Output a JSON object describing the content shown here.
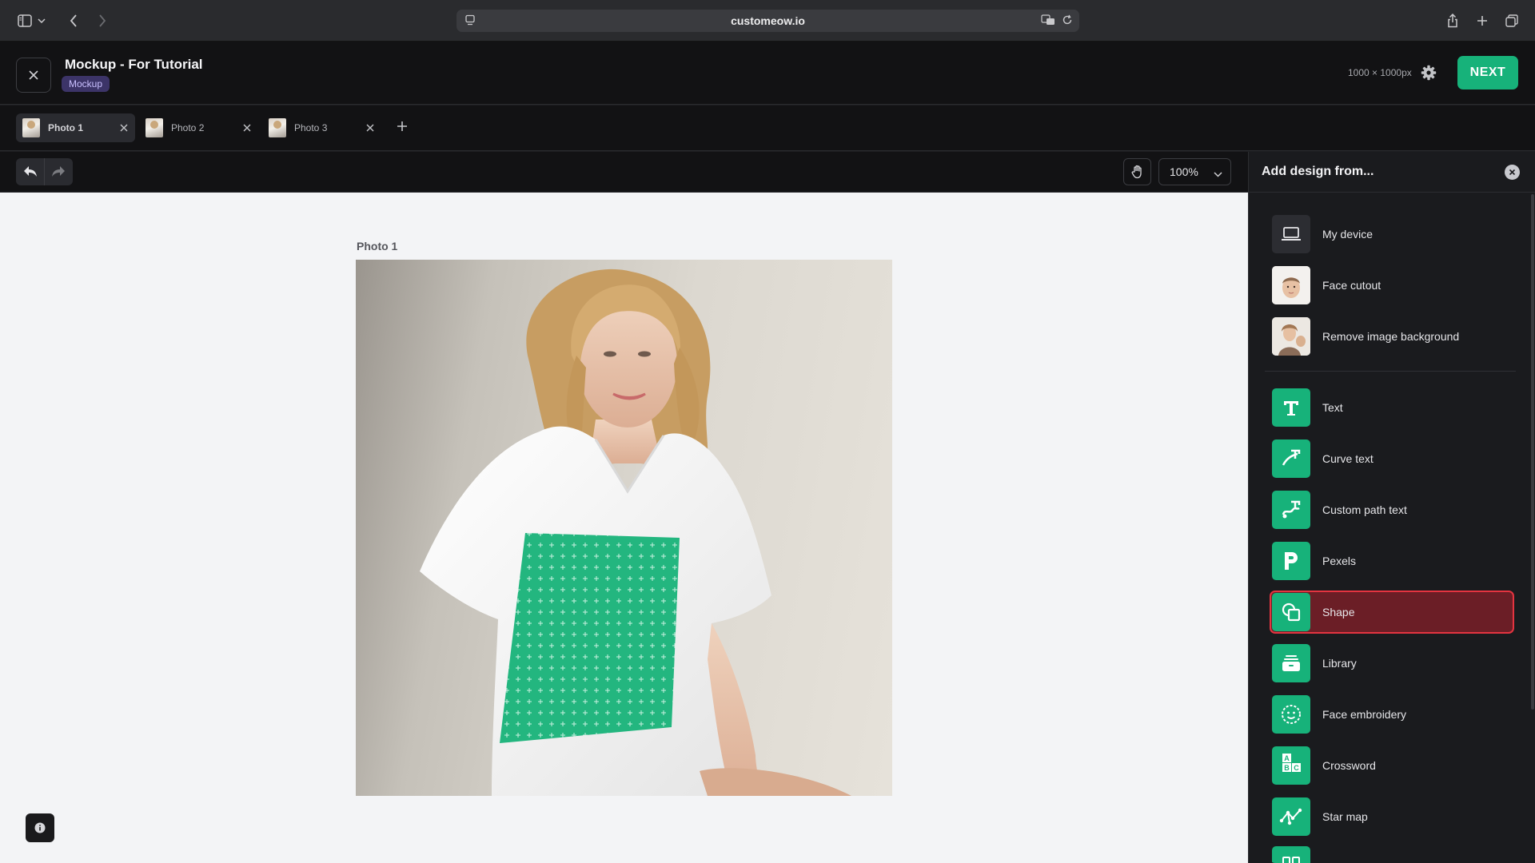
{
  "browser": {
    "url": "customeow.io"
  },
  "header": {
    "title": "Mockup - For Tutorial",
    "badge": "Mockup",
    "canvas_size": "1000 × 1000px",
    "next_label": "NEXT"
  },
  "tabs": [
    {
      "label": "Photo 1",
      "active": true
    },
    {
      "label": "Photo 2",
      "active": false
    },
    {
      "label": "Photo 3",
      "active": false
    }
  ],
  "toolbar": {
    "zoom": "100%"
  },
  "canvas": {
    "photo_label": "Photo 1"
  },
  "panel": {
    "title": "Add design from...",
    "items": [
      {
        "label": "My device",
        "icon": "laptop-icon"
      },
      {
        "label": "Face cutout",
        "icon": "face-cutout-icon"
      },
      {
        "label": "Remove image background",
        "icon": "remove-bg-icon"
      },
      {
        "label": "Text",
        "icon": "text-icon"
      },
      {
        "label": "Curve text",
        "icon": "curve-text-icon"
      },
      {
        "label": "Custom path text",
        "icon": "path-text-icon"
      },
      {
        "label": "Pexels",
        "icon": "pexels-icon"
      },
      {
        "label": "Shape",
        "icon": "shape-icon",
        "selected": true
      },
      {
        "label": "Library",
        "icon": "library-icon"
      },
      {
        "label": "Face embroidery",
        "icon": "embroidery-icon"
      },
      {
        "label": "Crossword",
        "icon": "crossword-icon"
      },
      {
        "label": "Star map",
        "icon": "star-map-icon"
      }
    ]
  },
  "colors": {
    "accent": "#17b27a",
    "badge_bg": "#3c3468",
    "selected_border": "#e43440",
    "selected_bg": "#6b1e26"
  }
}
